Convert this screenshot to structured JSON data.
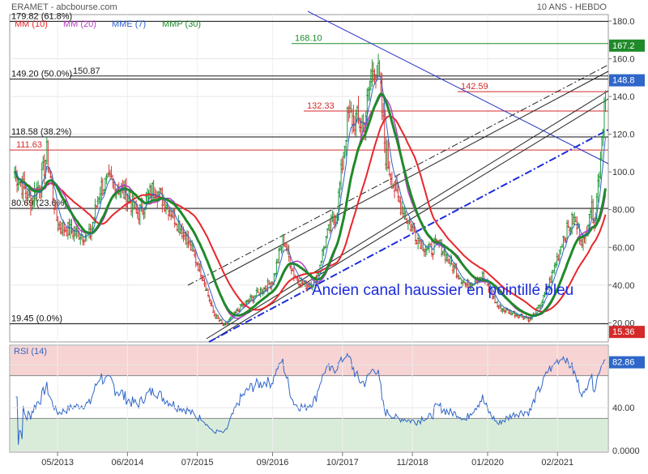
{
  "header": {
    "symbol": "ERAMET - abcbourse.com",
    "period": "10 ANS - HEBDO"
  },
  "legend": [
    {
      "label": "MM (10)",
      "color": "#e8262a"
    },
    {
      "label": "MM (20)",
      "color": "#b63ec4"
    },
    {
      "label": "MME (7)",
      "color": "#2e5fd0"
    },
    {
      "label": "MMP (30)",
      "color": "#1f8a2a"
    }
  ],
  "colors": {
    "price_up": "#1f9a3a",
    "price_down": "#d63a3a",
    "ema": "#2f66c8",
    "sma10": "#e8262a",
    "wma30": "#1f8a2a",
    "channel": "#222222",
    "blue_channel": "#1a2bdc",
    "downtrend": "#2a33c8",
    "rsi_line": "#2f66c8",
    "rsi_overbought": "#f7d3d3",
    "rsi_oversold": "#d9ecd9"
  },
  "price_axis": {
    "min": 10,
    "max": 180,
    "ticks": [
      "20.00",
      "40.00",
      "60.00",
      "80.00",
      "100.0",
      "120.0",
      "140.0",
      "160.0",
      "180.0"
    ]
  },
  "x_labels": [
    "05/2013",
    "06/2014",
    "07/2015",
    "09/2016",
    "10/2017",
    "11/2018",
    "01/2020",
    "02/2021"
  ],
  "fib_levels": [
    {
      "label": "179.82  (61.8%)",
      "value": 179.82
    },
    {
      "label": "149.20  (50.0%)",
      "value": 149.2
    },
    {
      "label": "118.58  (38.2%)",
      "value": 118.58
    },
    {
      "label": "80.69  (23.6%)",
      "value": 80.69
    },
    {
      "label": "19.45  (0.0%)",
      "value": 19.45
    }
  ],
  "level_labels": [
    {
      "label": "168.10",
      "value": 168.1,
      "color": "#1f8a2a"
    },
    {
      "label": "150.87",
      "value": 150.87,
      "color": "#222222"
    },
    {
      "label": "142.59",
      "value": 142.59,
      "color": "#d42a2a"
    },
    {
      "label": "132.33",
      "value": 132.33,
      "color": "#d42a2a"
    },
    {
      "label": "111.63",
      "value": 111.63,
      "color": "#d42a2a"
    }
  ],
  "price_badges": [
    {
      "label": "167.2",
      "value": 167.2,
      "color": "#1f8a2a"
    },
    {
      "label": "148.8",
      "value": 148.8,
      "color": "#2f66c8"
    },
    {
      "label": "15.36",
      "value": 15.36,
      "color": "#d42a2a"
    }
  ],
  "annotation": "Ancien canal haussier en pointillé bleu",
  "rsi": {
    "title": "RSI (14)",
    "last_label": "82.86",
    "last_value": 82.86,
    "ticks": [
      "0.0000",
      "40.00",
      "80.00"
    ],
    "overbought": 70,
    "oversold": 30
  },
  "chart_data": {
    "type": "line",
    "title": "ERAMET - abcbourse.com",
    "period": "10 ANS - HEBDO",
    "x_range": [
      "2012-09",
      "2021-11"
    ],
    "ylim": [
      10,
      180
    ],
    "series": [
      {
        "name": "ERAMET",
        "points": [
          [
            "2012-09",
            100
          ],
          [
            "2012-12",
            85
          ],
          [
            "2013-02",
            95
          ],
          [
            "2013-03",
            110
          ],
          [
            "2013-05",
            72
          ],
          [
            "2013-08",
            68
          ],
          [
            "2013-11",
            66
          ],
          [
            "2014-01",
            92
          ],
          [
            "2014-03",
            95
          ],
          [
            "2014-05",
            90
          ],
          [
            "2014-08",
            78
          ],
          [
            "2014-11",
            92
          ],
          [
            "2015-02",
            80
          ],
          [
            "2015-05",
            65
          ],
          [
            "2015-08",
            45
          ],
          [
            "2015-10",
            25
          ],
          [
            "2015-12",
            18
          ],
          [
            "2016-03",
            28
          ],
          [
            "2016-06",
            35
          ],
          [
            "2016-09",
            42
          ],
          [
            "2016-11",
            65
          ],
          [
            "2017-01",
            45
          ],
          [
            "2017-03",
            40
          ],
          [
            "2017-05",
            42
          ],
          [
            "2017-07",
            65
          ],
          [
            "2017-09",
            80
          ],
          [
            "2017-11",
            130
          ],
          [
            "2018-02",
            125
          ],
          [
            "2018-04",
            160
          ],
          [
            "2018-05",
            145
          ],
          [
            "2018-06",
            110
          ],
          [
            "2018-08",
            88
          ],
          [
            "2018-10",
            75
          ],
          [
            "2018-12",
            65
          ],
          [
            "2019-02",
            58
          ],
          [
            "2019-04",
            62
          ],
          [
            "2019-06",
            52
          ],
          [
            "2019-09",
            40
          ],
          [
            "2019-12",
            45
          ],
          [
            "2020-03",
            28
          ],
          [
            "2020-06",
            25
          ],
          [
            "2020-09",
            22
          ],
          [
            "2020-11",
            30
          ],
          [
            "2021-01",
            45
          ],
          [
            "2021-03",
            65
          ],
          [
            "2021-05",
            75
          ],
          [
            "2021-07",
            62
          ],
          [
            "2021-08",
            82
          ],
          [
            "2021-09",
            75
          ],
          [
            "2021-10",
            110
          ],
          [
            "2021-11",
            148.8
          ]
        ]
      }
    ]
  }
}
